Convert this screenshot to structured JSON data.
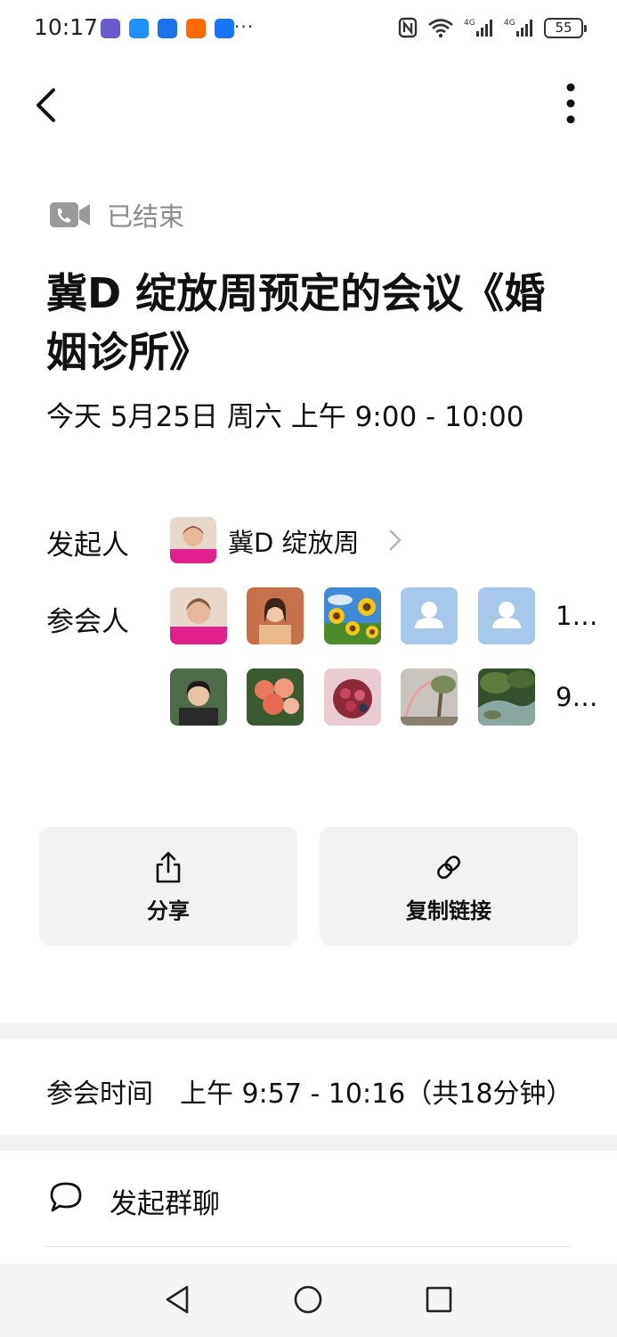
{
  "status_bar": {
    "time": "10:17",
    "more": "···",
    "battery": "55",
    "app_icons": [
      {
        "name": "notify-app-1-icon",
        "color": "#6a5acd"
      },
      {
        "name": "notify-app-2-icon",
        "color": "#1e90ff"
      },
      {
        "name": "notify-app-3-icon",
        "color": "#1a73e8"
      },
      {
        "name": "notify-app-4-icon",
        "color": "#ff6a00"
      },
      {
        "name": "alipay-icon",
        "color": "#1677ff"
      }
    ]
  },
  "meeting": {
    "status": "已结束",
    "title": "冀D 绽放周预定的会议《婚姻诊所》",
    "datetime": "今天 5月25日 周六 上午 9:00 - 10:00"
  },
  "host": {
    "label": "发起人",
    "name": "冀D 绽放周"
  },
  "participants": {
    "label": "参会人",
    "row1_more": "1…",
    "row2_more": "9…"
  },
  "actions": {
    "share": "分享",
    "copy_link": "复制链接"
  },
  "attendance": {
    "label": "参会时间",
    "value": "上午 9:57 - 10:16（共18分钟）"
  },
  "group_chat": {
    "label": "发起群聊"
  },
  "colors": {
    "muted_text": "#8c8c8c",
    "button_bg": "#f2f2f2",
    "divider": "#f1f1f1",
    "placeholder_avatar": "#a8c8ea"
  }
}
